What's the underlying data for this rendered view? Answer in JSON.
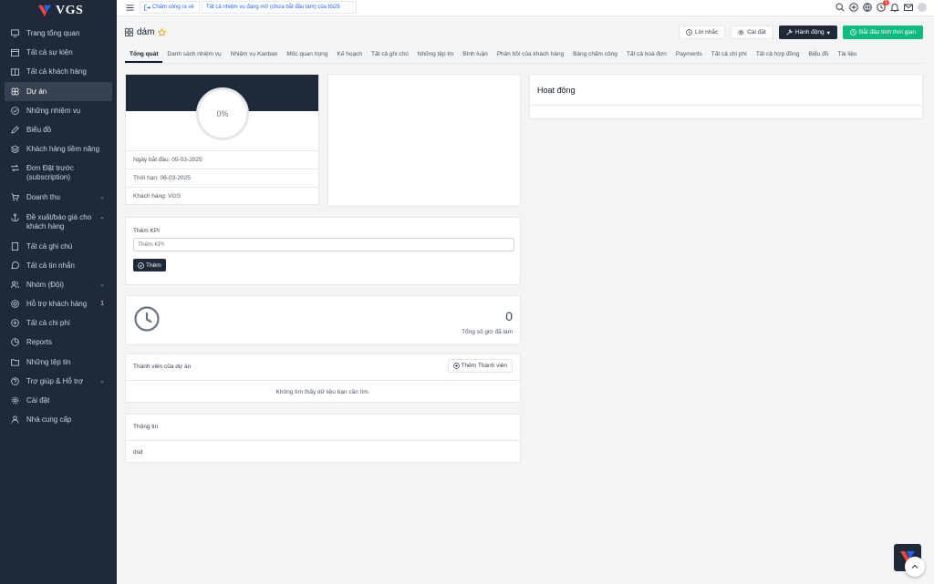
{
  "brand": {
    "name": "VGS"
  },
  "sidebar": {
    "items": [
      {
        "label": "Trang tổng quan",
        "icon": "monitor-icon"
      },
      {
        "label": "Tất cả sự kiện",
        "icon": "calendar-icon"
      },
      {
        "label": "Tất cả khách hàng",
        "icon": "building-icon"
      },
      {
        "label": "Dự án",
        "icon": "command-icon"
      },
      {
        "label": "Những nhiệm vụ",
        "icon": "check-circle-icon"
      },
      {
        "label": "Biểu đồ",
        "icon": "pen-icon"
      },
      {
        "label": "Khách hàng tiềm năng",
        "icon": "layers-icon"
      },
      {
        "label": "Đơn Đặt trước (subscription)",
        "icon": "repeat-icon"
      },
      {
        "label": "Doanh thu",
        "icon": "cart-icon"
      },
      {
        "label": "Đề xuất/báo giá cho khách hàng",
        "icon": "anchor-icon"
      },
      {
        "label": "Tất cả ghi chú",
        "icon": "book-icon"
      },
      {
        "label": "Tất cả tin nhắn",
        "icon": "message-icon"
      },
      {
        "label": "Nhóm (Đội)",
        "icon": "users-icon"
      },
      {
        "label": "Hỗ trợ khách hàng",
        "icon": "lifebuoy-icon",
        "count": "1"
      },
      {
        "label": "Tất cả chi phí",
        "icon": "plus-circle-icon"
      },
      {
        "label": "Reports",
        "icon": "chart-pie-icon"
      },
      {
        "label": "Những tệp tin",
        "icon": "folder-icon"
      },
      {
        "label": "Trợ giúp & Hỗ trợ",
        "icon": "help-circle-icon"
      },
      {
        "label": "Cài đặt",
        "icon": "gear-icon"
      },
      {
        "label": "Nhà cung cấp",
        "icon": "user-icon"
      }
    ]
  },
  "topbar": {
    "clock_out": "Chấm công ra về",
    "task_notice": "Tất cả nhiệm vụ đang mở (chưa bắt đầu làm) của tôi29",
    "notification_badge": "1"
  },
  "header": {
    "title": "dám",
    "reminder_label": "Lời nhắc",
    "settings_label": "Cài đặt",
    "actions_label": "Hành động",
    "timer_label": "Bắt đầu tính thời gian"
  },
  "tabs": [
    {
      "label": "Tổng quát",
      "active": true
    },
    {
      "label": "Danh sách nhiệm vụ"
    },
    {
      "label": "Nhiệm vụ Kanban"
    },
    {
      "label": "Mốc quan trọng"
    },
    {
      "label": "Kế hoạch"
    },
    {
      "label": "Tất cả ghi chú"
    },
    {
      "label": "Những tệp tin"
    },
    {
      "label": "Bình luận"
    },
    {
      "label": "Phản hồi của khách hàng"
    },
    {
      "label": "Bảng chấm công"
    },
    {
      "label": "Tất cả hoá đơn"
    },
    {
      "label": "Payments"
    },
    {
      "label": "Tất cả chi phí"
    },
    {
      "label": "Tất cả hợp đồng"
    },
    {
      "label": "Biểu đồ"
    },
    {
      "label": "Tài liệu"
    }
  ],
  "overview": {
    "progress_percent": "0%",
    "start_date": "Ngày bắt đầu: 05-03-2025",
    "deadline": "Thời hạn: 06-03-2025",
    "client": "Khách hàng: VGS"
  },
  "activity": {
    "title": "Hoạt động"
  },
  "kpi": {
    "label": "Thêm KPI",
    "placeholder": "Thêm KPI",
    "button": "Thêm"
  },
  "time": {
    "total_hours": "0",
    "label": "Tổng số giờ đã làm"
  },
  "members": {
    "title": "Thành viên của dự án",
    "add_button": "Thêm Thành viên",
    "empty": "Không tìm thấy dữ liệu bạn cần tìm."
  },
  "info": {
    "title": "Thông tin",
    "text": "dsd"
  }
}
